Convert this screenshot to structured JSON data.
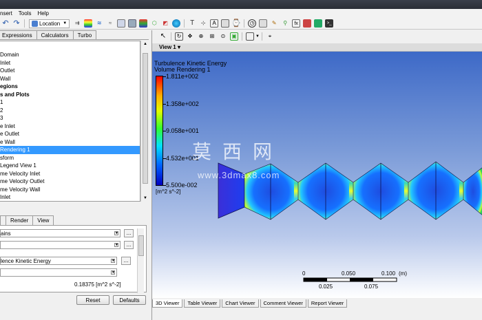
{
  "menu": [
    "nsert",
    "Tools",
    "Help"
  ],
  "toolbar": {
    "location_label": "Location"
  },
  "left_tabs": [
    "Expressions",
    "Calculators",
    "Turbo"
  ],
  "tree": [
    {
      "label": "Domain",
      "style": ""
    },
    {
      "label": "Inlet",
      "style": ""
    },
    {
      "label": "Outlet",
      "style": ""
    },
    {
      "label": "Wall",
      "style": ""
    },
    {
      "label": "egions",
      "style": "bold"
    },
    {
      "label": "s and Plots",
      "style": "bold"
    },
    {
      "label": "1",
      "style": ""
    },
    {
      "label": "2",
      "style": ""
    },
    {
      "label": "3",
      "style": ""
    },
    {
      "label": "e Inlet",
      "style": ""
    },
    {
      "label": "e Outlet",
      "style": ""
    },
    {
      "label": "e Wall",
      "style": ""
    },
    {
      "label": "Rendering 1",
      "style": "sel"
    },
    {
      "label": "sform",
      "style": ""
    },
    {
      "label": "Legend View 1",
      "style": ""
    },
    {
      "label": "me Velocity Inlet",
      "style": ""
    },
    {
      "label": "me Velocity Outlet",
      "style": ""
    },
    {
      "label": "me Velocity Wall",
      "style": ""
    },
    {
      "label": "Inlet",
      "style": ""
    }
  ],
  "detail_tabs": [
    "",
    "Render",
    "View"
  ],
  "details": {
    "domains": "ains",
    "variable": "lence Kinetic Energy",
    "dots": "...",
    "value": "0.18375 [m^2 s^-2]"
  },
  "buttons": {
    "reset": "Reset",
    "defaults": "Defaults"
  },
  "view": {
    "label": "View 1 ▾"
  },
  "viewport": {
    "title": "Turbulence Kinetic Energy",
    "subtitle": "Volume Rendering 1",
    "legend": [
      "1.811e+002",
      "1.358e+002",
      "9.058e+001",
      "4.532e+001",
      "5.500e-002"
    ],
    "units": "[m^2 s^-2]",
    "watermark": "莫西网",
    "watermark_url": "www.3dmax8.com",
    "scale_top": [
      "0",
      "0.050",
      "0.100",
      "(m)"
    ],
    "scale_bottom": [
      "0.025",
      "0.075"
    ]
  },
  "viewer_tabs": [
    "3D Viewer",
    "Table Viewer",
    "Chart Viewer",
    "Comment Viewer",
    "Report Viewer"
  ]
}
